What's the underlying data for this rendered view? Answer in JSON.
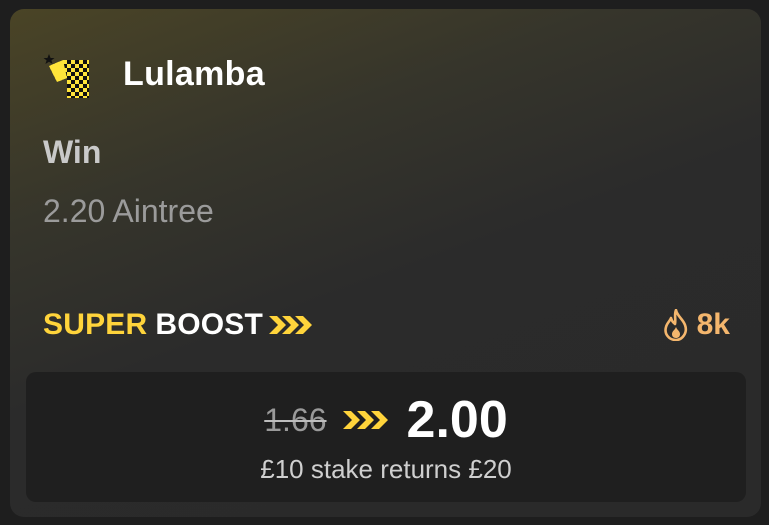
{
  "selection": {
    "horse_name": "Lulamba",
    "market": "Win",
    "race": "2.20 Aintree",
    "silks_icon": "jockey-silks-icon"
  },
  "boost": {
    "label_super": "SUPER",
    "label_boost": "BOOST",
    "chevrons_icon": "triple-chevron-right-icon",
    "popularity_icon": "flame-icon",
    "popularity_count": "8k"
  },
  "odds": {
    "old_price": "1.66",
    "new_price": "2.00",
    "returns_text": "£10 stake returns £20"
  },
  "colors": {
    "accent_yellow": "#ffd43b",
    "flame_orange": "#f4b66d",
    "card_bg": "#2a2a2a",
    "panel_bg": "#1f1f1f"
  }
}
